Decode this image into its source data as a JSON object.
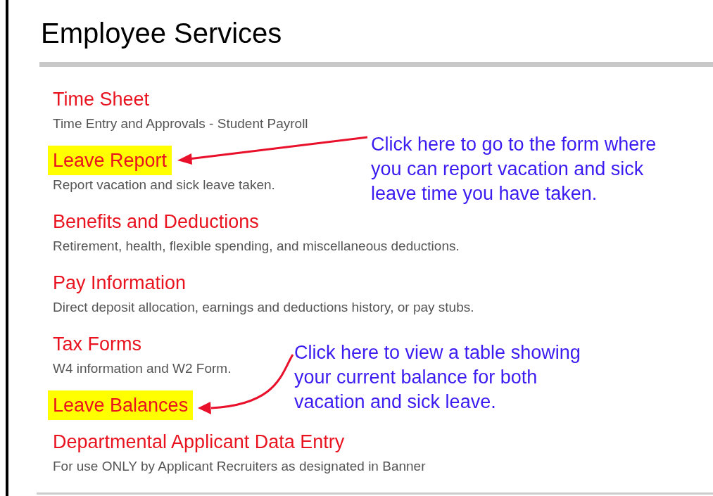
{
  "heading": "Employee Services",
  "items": [
    {
      "title": "Time Sheet",
      "description": "Time Entry and Approvals - Student Payroll",
      "highlighted": false
    },
    {
      "title": "Leave Report",
      "description": "Report vacation and sick leave taken.",
      "highlighted": true
    },
    {
      "title": "Benefits and Deductions",
      "description": "Retirement, health, flexible spending, and miscellaneous deductions.",
      "highlighted": false
    },
    {
      "title": "Pay Information",
      "description": "Direct deposit allocation, earnings and deductions history, or pay stubs.",
      "highlighted": false
    },
    {
      "title": "Tax Forms",
      "description": "W4 information and W2 Form.",
      "highlighted": false
    },
    {
      "title": "Leave Balances",
      "highlighted": true
    },
    {
      "title": "Departmental Applicant Data Entry",
      "description": "For use ONLY by Applicant Recruiters as designated in Banner",
      "highlighted": false
    }
  ],
  "callouts": [
    {
      "lines": [
        "Click here to go to the form where",
        "you can report vacation and sick",
        "leave time you have taken."
      ]
    },
    {
      "lines": [
        "Click here to view a table showing",
        "your current balance for both",
        "vacation and sick leave."
      ]
    }
  ]
}
